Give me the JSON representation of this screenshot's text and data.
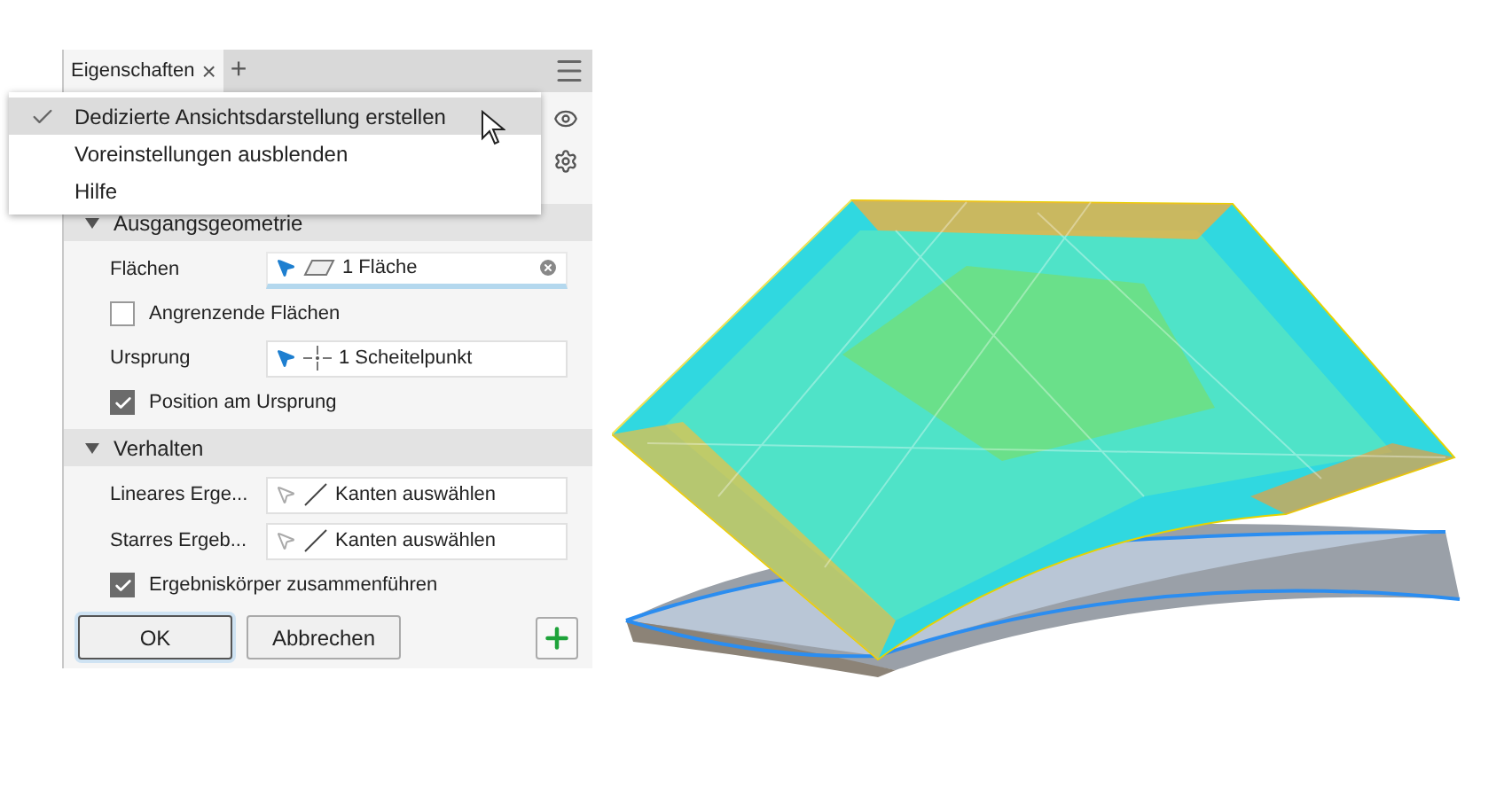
{
  "panel": {
    "tab": {
      "label": "Eigenschaften",
      "close": "×",
      "add": "+"
    },
    "sections": [
      {
        "title": "Ausgangsgeometrie",
        "expanded": true,
        "rows": [
          {
            "kind": "face",
            "label": "Flächen",
            "value": "1 Fläche",
            "active": true,
            "empty": false
          },
          {
            "kind": "check",
            "label": "Angrenzende Flächen",
            "checked": false
          },
          {
            "kind": "point",
            "label": "Ursprung",
            "value": "1 Scheitelpunkt",
            "active": false,
            "empty": false
          },
          {
            "kind": "check",
            "label": "Position am Ursprung",
            "checked": true
          }
        ]
      },
      {
        "title": "Verhalten",
        "expanded": true,
        "rows": [
          {
            "kind": "edge",
            "label": "Lineares Erge...",
            "value": "Kanten auswählen",
            "active": false,
            "empty": true
          },
          {
            "kind": "edge",
            "label": "Starres Ergeb...",
            "value": "Kanten auswählen",
            "active": false,
            "empty": true
          },
          {
            "kind": "check",
            "label": "Ergebniskörper zusammenführen",
            "checked": true
          }
        ]
      }
    ],
    "buttons": [
      {
        "label": "OK",
        "default": true
      },
      {
        "label": "Abbrechen",
        "default": false
      }
    ]
  },
  "menu": {
    "items": [
      {
        "label": "Dedizierte Ansichtsdarstellung erstellen",
        "checked": true,
        "selected": true
      },
      {
        "label": "Voreinstellungen ausblenden",
        "checked": false,
        "selected": false
      },
      {
        "label": "Hilfe",
        "checked": false,
        "selected": false
      }
    ]
  }
}
